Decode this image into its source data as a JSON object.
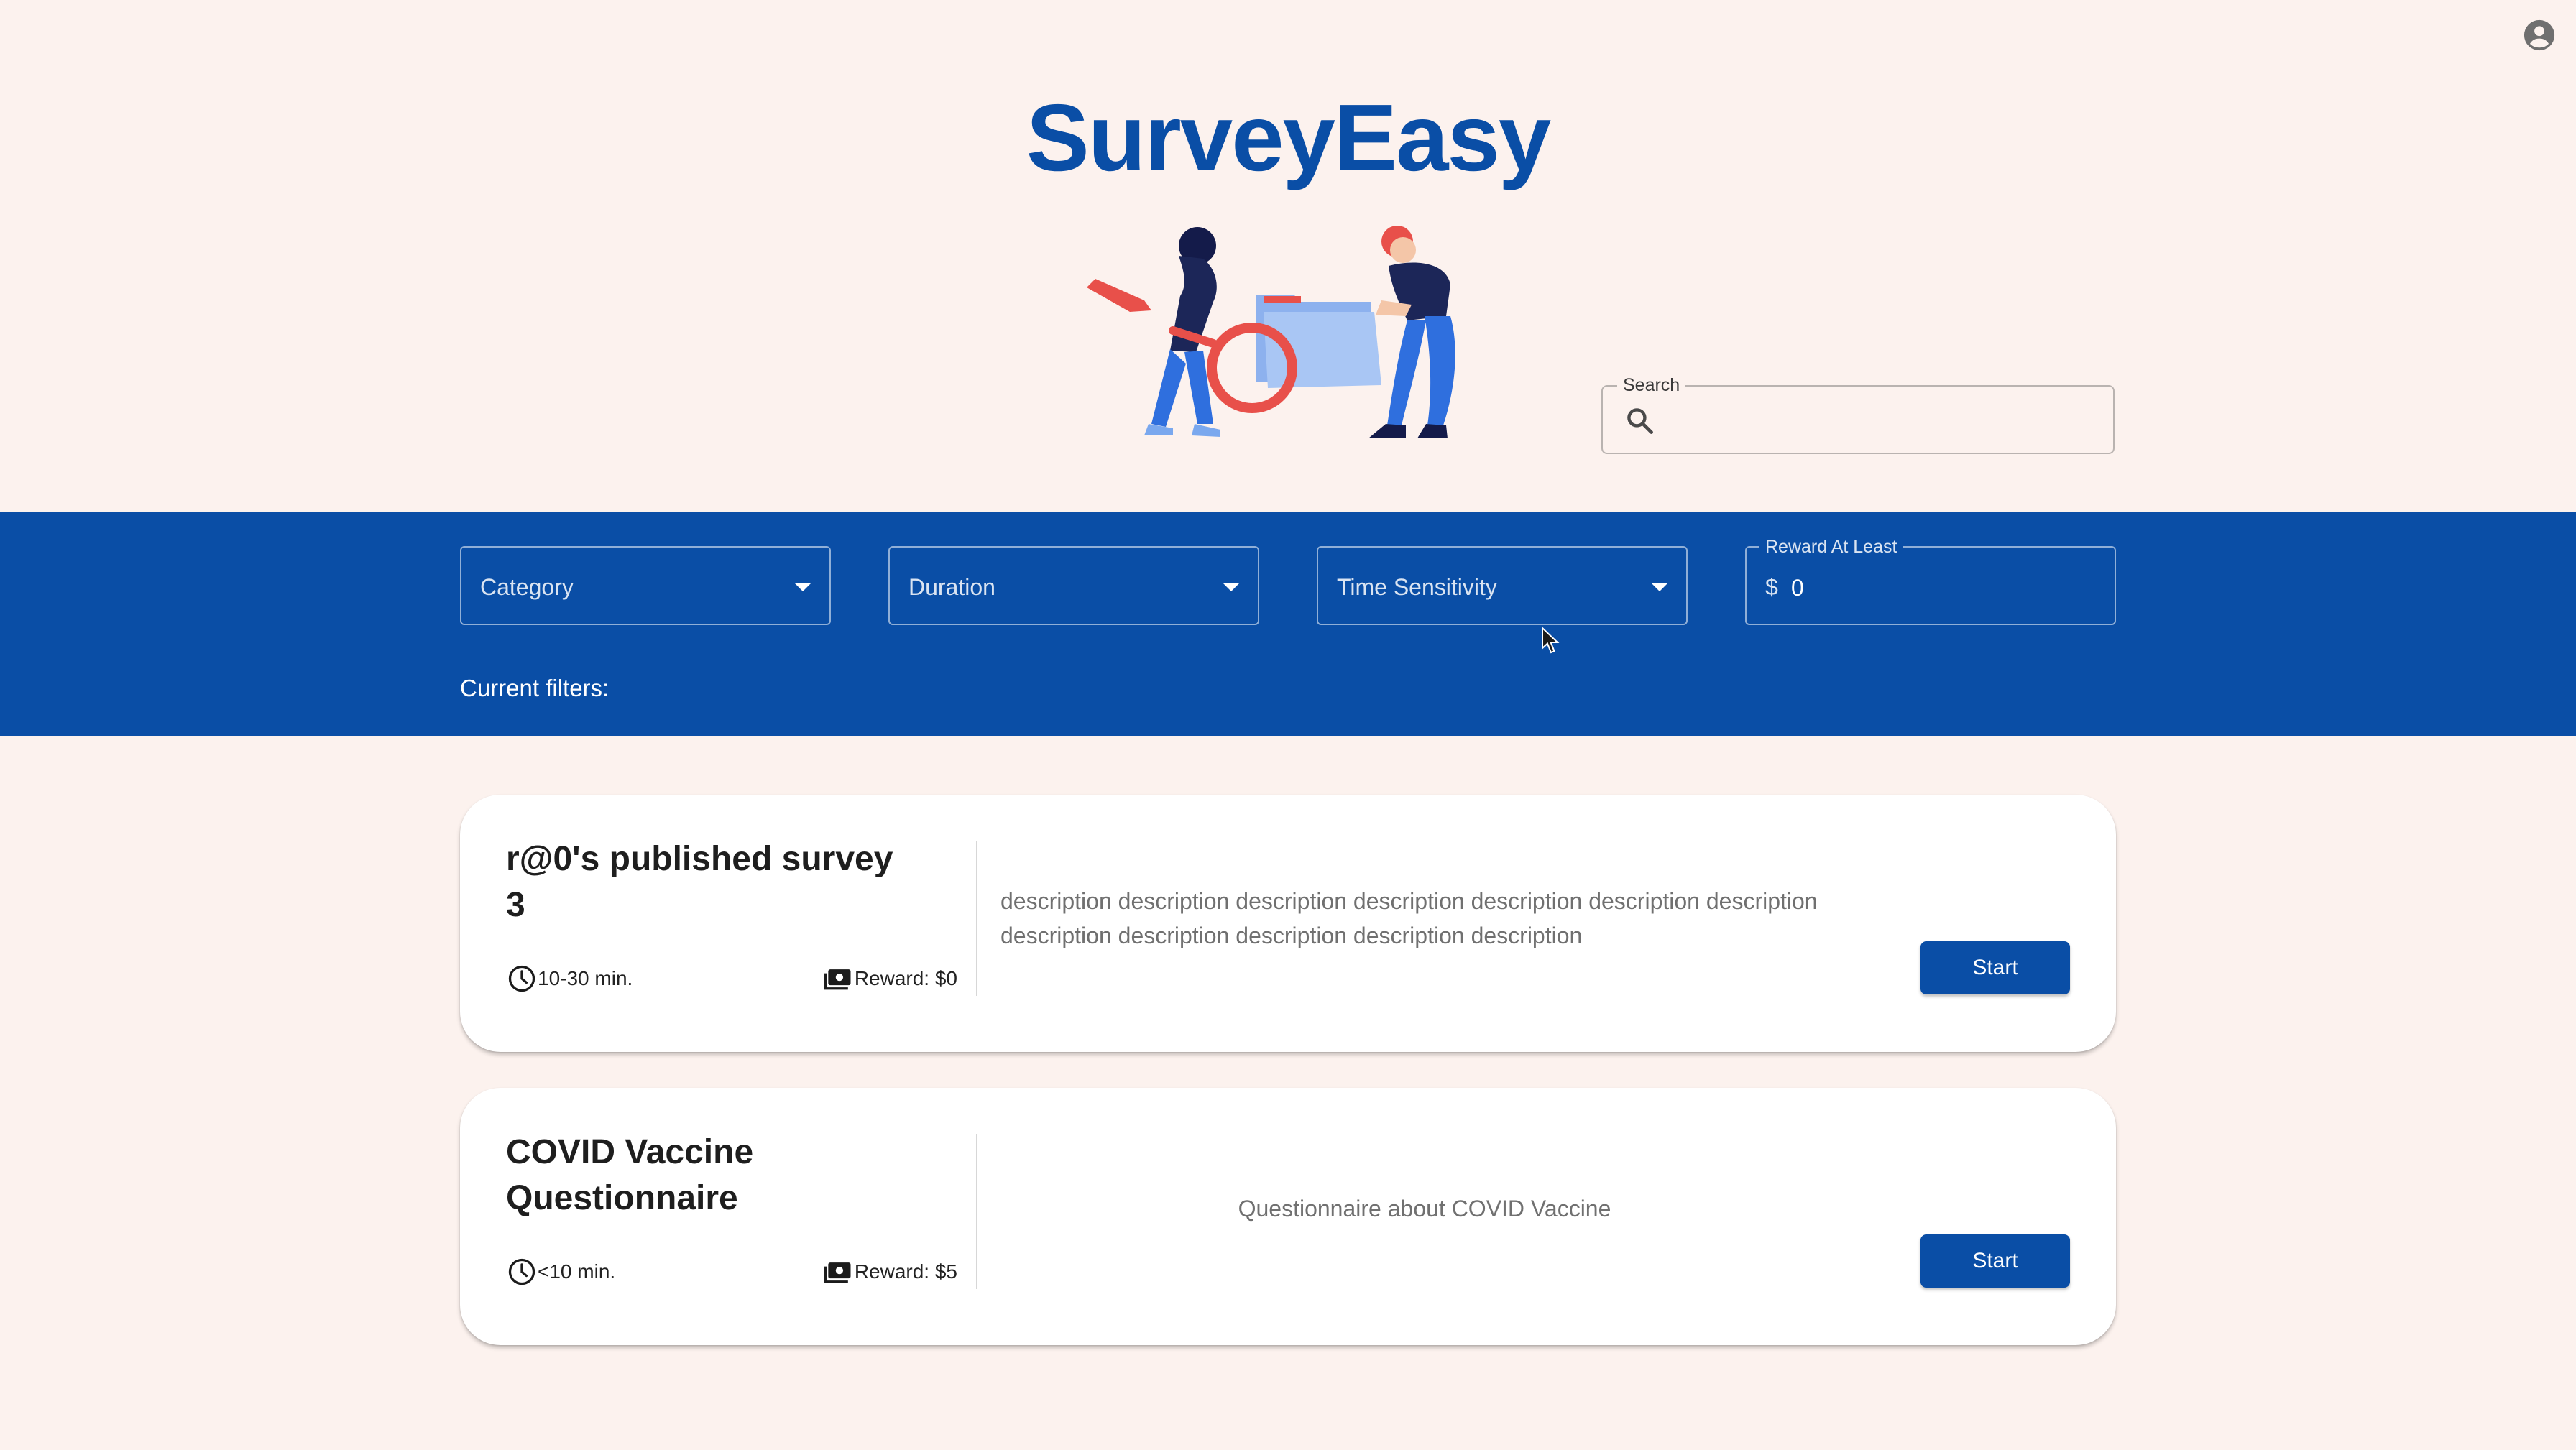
{
  "app": {
    "title": "SurveyEasy",
    "account_icon": "account-circle-icon"
  },
  "search": {
    "label": "Search",
    "value": "",
    "placeholder": "",
    "icon": "search-icon"
  },
  "filters": {
    "category_label": "Category",
    "duration_label": "Duration",
    "time_sensitivity_label": "Time Sensitivity",
    "reward": {
      "label": "Reward At Least",
      "prefix": "$",
      "value": "0"
    },
    "current_filters_label": "Current filters:"
  },
  "surveys": [
    {
      "title": "r@0's published survey 3",
      "duration": "10-30 min.",
      "reward": "Reward: $0",
      "description": "description description description description description description description description description description description description",
      "start_label": "Start"
    },
    {
      "title": "COVID Vaccine Questionnaire",
      "duration": "<10 min.",
      "reward": "Reward: $5",
      "description": "Questionnaire about COVID Vaccine",
      "start_label": "Start"
    }
  ],
  "colors": {
    "background": "#fcf2ee",
    "primary": "#0a4ea6",
    "card": "#ffffff",
    "description_text": "#707070"
  }
}
